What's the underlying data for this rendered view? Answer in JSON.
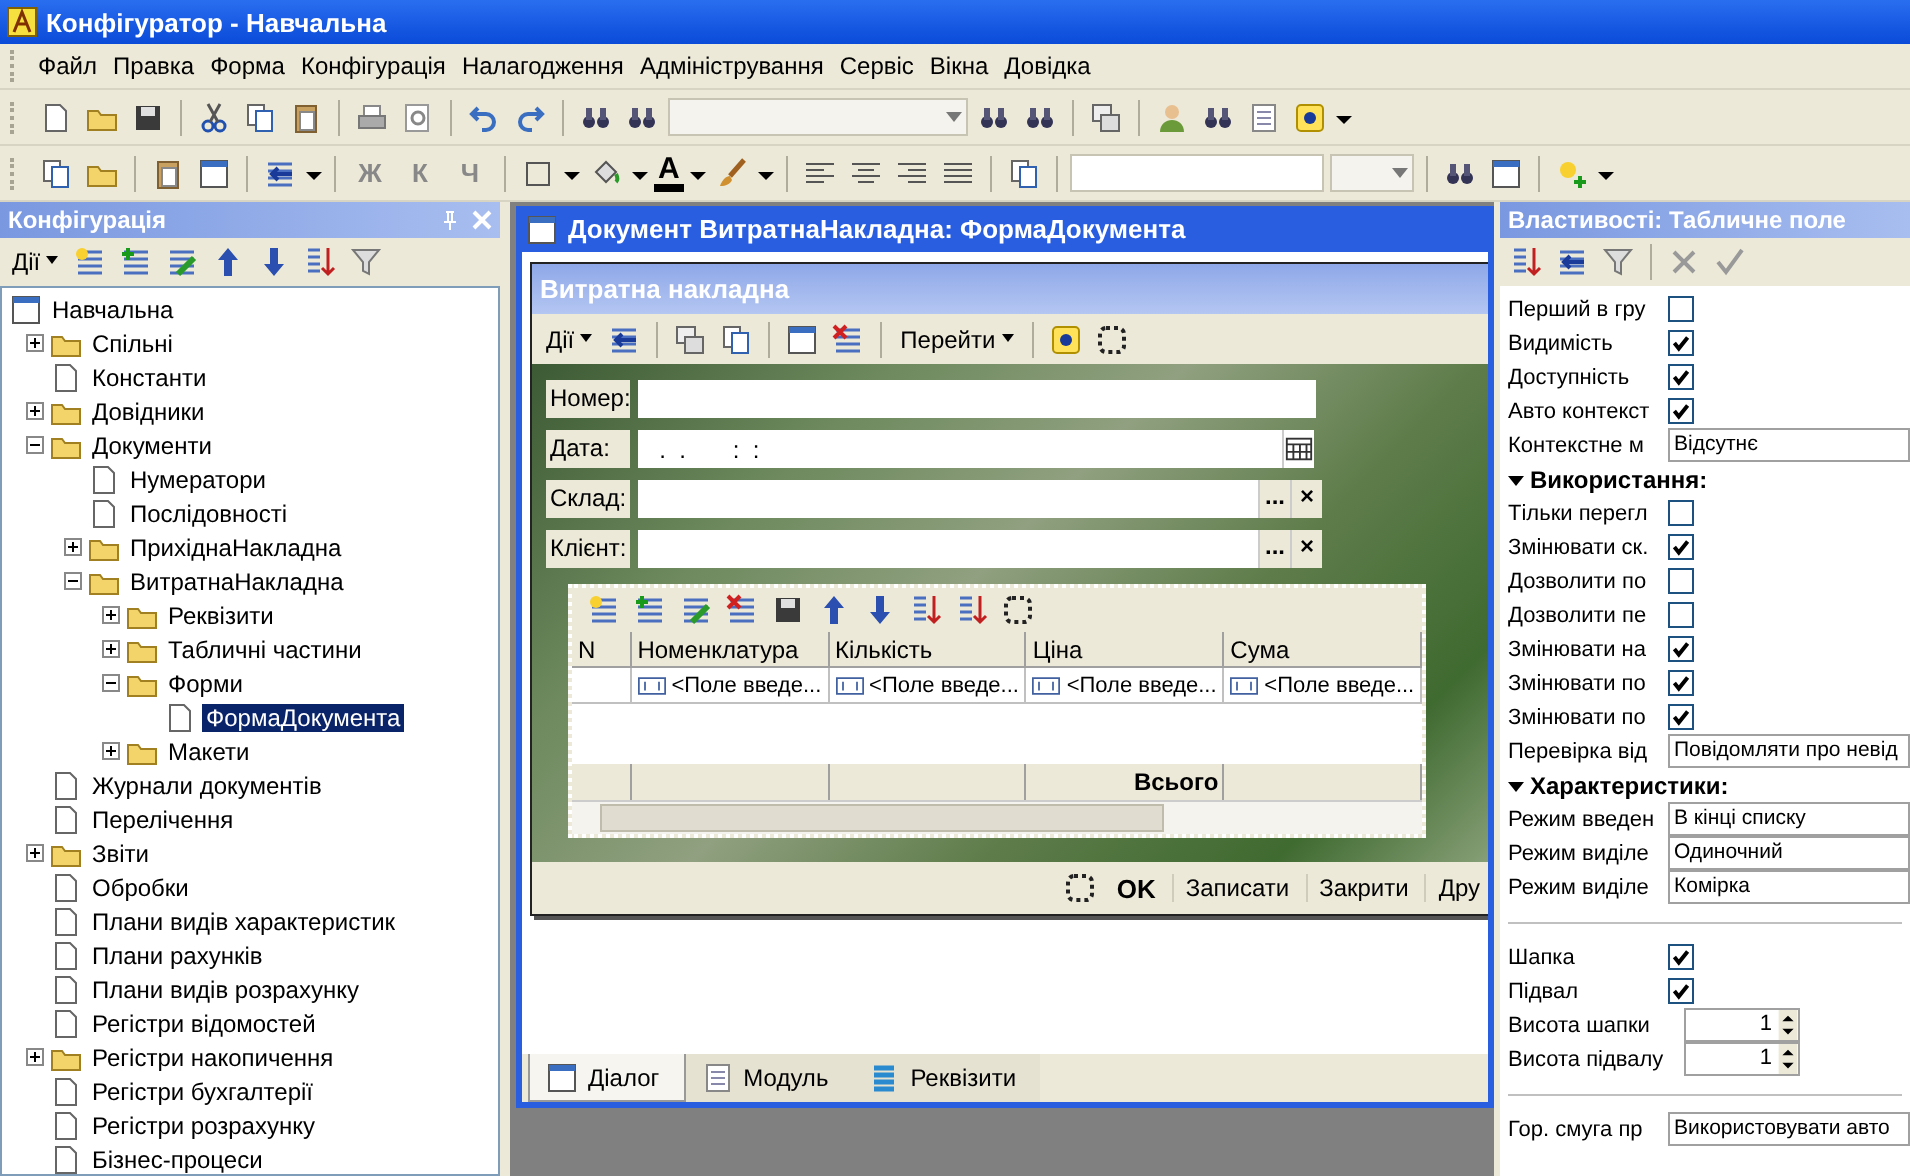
{
  "window": {
    "title": "Конфігуратор - Навчальна"
  },
  "menu": [
    "Файл",
    "Правка",
    "Форма",
    "Конфігурація",
    "Налагодження",
    "Адміністрування",
    "Сервіс",
    "Вікна",
    "Довідка"
  ],
  "format_toolbar": {
    "letters": [
      "Ж",
      "К",
      "Ч"
    ],
    "font_color_letter": "A"
  },
  "config_panel": {
    "title": "Конфігурація",
    "actions_label": "Дії",
    "tree": [
      {
        "label": "Навчальна",
        "selected": false,
        "children": [
          {
            "label": "Спільні",
            "selected": false,
            "expanded": false
          },
          {
            "label": "Константи",
            "selected": false
          },
          {
            "label": "Довідники",
            "selected": false,
            "expanded": false
          },
          {
            "label": "Документи",
            "selected": false,
            "expanded": true,
            "children": [
              {
                "label": "Нумератори",
                "selected": false
              },
              {
                "label": "Послідовності",
                "selected": false
              },
              {
                "label": "ПрихіднаНакладна",
                "selected": false,
                "expanded": false
              },
              {
                "label": "ВитратнаНакладна",
                "selected": false,
                "expanded": true,
                "children": [
                  {
                    "label": "Реквізити",
                    "selected": false,
                    "expanded": false
                  },
                  {
                    "label": "Табличні частини",
                    "selected": false,
                    "expanded": false
                  },
                  {
                    "label": "Форми",
                    "selected": false,
                    "expanded": true,
                    "children": [
                      {
                        "label": "ФормаДокумента",
                        "selected": true
                      }
                    ]
                  },
                  {
                    "label": "Макети",
                    "selected": false,
                    "expanded": false
                  }
                ]
              }
            ]
          },
          {
            "label": "Журнали документів",
            "selected": false
          },
          {
            "label": "Перелічення",
            "selected": false
          },
          {
            "label": "Звіти",
            "selected": false,
            "expanded": false
          },
          {
            "label": "Обробки",
            "selected": false
          },
          {
            "label": "Плани видів характеристик",
            "selected": false
          },
          {
            "label": "Плани рахунків",
            "selected": false
          },
          {
            "label": "Плани видів розрахунку",
            "selected": false
          },
          {
            "label": "Регістри відомостей",
            "selected": false
          },
          {
            "label": "Регістри накопичення",
            "selected": false,
            "expanded": false
          },
          {
            "label": "Регістри бухгалтерії",
            "selected": false
          },
          {
            "label": "Регістри розрахунку",
            "selected": false
          },
          {
            "label": "Бізнес-процеси",
            "selected": false
          }
        ]
      }
    ]
  },
  "document_window": {
    "title": "Документ ВитратнаНакладна: ФормаДокумента",
    "form": {
      "title": "Витратна накладна",
      "actions_label": "Дії",
      "goto_label": "Перейти",
      "fields": [
        {
          "kind": "text",
          "label": "Номер:"
        },
        {
          "kind": "date",
          "label": "Дата:",
          "value": "  .  .       :  :"
        },
        {
          "kind": "ref",
          "label": "Склад:",
          "buttons": [
            "...",
            "×"
          ]
        },
        {
          "kind": "ref",
          "label": "Клієнт:",
          "buttons": [
            "...",
            "×"
          ]
        }
      ],
      "table": {
        "columns": [
          "N",
          "Номенклатура",
          "Кількість",
          "Ціна",
          "Сума"
        ],
        "rows": [
          [
            null,
            "<Поле введе...",
            "<Поле введе...",
            "<Поле введе...",
            "<Поле введе..."
          ]
        ],
        "footer": [
          {
            "kind": "empty"
          },
          {
            "kind": "empty"
          },
          {
            "kind": "empty"
          },
          {
            "kind": "total",
            "text": "Всього"
          },
          {
            "kind": "empty"
          }
        ]
      },
      "buttons": [
        {
          "label": "OK",
          "kind": "default"
        },
        {
          "label": "Записати",
          "kind": "plain"
        },
        {
          "label": "Закрити",
          "kind": "plain"
        },
        {
          "label": "Дру",
          "kind": "plain"
        }
      ]
    },
    "tabs": [
      {
        "label": "Діалог",
        "selected": true
      },
      {
        "label": "Модуль",
        "selected": false
      },
      {
        "label": "Реквізити",
        "selected": false
      }
    ]
  },
  "properties": {
    "title": "Властивості: Табличне поле",
    "rows": [
      {
        "kind": "check",
        "label": "Перший в гру",
        "checked": false
      },
      {
        "kind": "check",
        "label": "Видимість",
        "checked": true
      },
      {
        "kind": "check",
        "label": "Доступність",
        "checked": true
      },
      {
        "kind": "check",
        "label": "Авто контекст",
        "checked": true
      },
      {
        "kind": "select",
        "label": "Контекстне м",
        "value": "Відсутнє"
      },
      {
        "kind": "section",
        "label": "Використання:",
        "expanded": true
      },
      {
        "kind": "check",
        "label": "Тільки перегл",
        "checked": false
      },
      {
        "kind": "check",
        "label": "Змінювати ск.",
        "checked": true
      },
      {
        "kind": "check",
        "label": "Дозволити по",
        "checked": false
      },
      {
        "kind": "check",
        "label": "Дозволити пе",
        "checked": false
      },
      {
        "kind": "check",
        "label": "Змінювати на",
        "checked": true
      },
      {
        "kind": "check",
        "label": "Змінювати по",
        "checked": true
      },
      {
        "kind": "check",
        "label": "Змінювати по",
        "checked": true
      },
      {
        "kind": "select",
        "label": "Перевірка від",
        "value": "Повідомляти про невід"
      },
      {
        "kind": "section",
        "label": "Характеристики:",
        "expanded": true
      },
      {
        "kind": "select",
        "label": "Режим введен",
        "value": "В кінці списку"
      },
      {
        "kind": "select",
        "label": "Режим виділе",
        "value": "Одиночний"
      },
      {
        "kind": "select",
        "label": "Режим виділе",
        "value": "Комірка"
      },
      {
        "kind": "separator"
      },
      {
        "kind": "check",
        "label": "Шапка",
        "checked": true
      },
      {
        "kind": "check",
        "label": "Підвал",
        "checked": true
      },
      {
        "kind": "spin",
        "label": "Висота шапки",
        "value": "1"
      },
      {
        "kind": "spin",
        "label": "Висота підвалу",
        "value": "1"
      },
      {
        "kind": "separator"
      },
      {
        "kind": "select",
        "label": "Гор. смуга пр",
        "value": "Використовувати авто"
      }
    ]
  }
}
